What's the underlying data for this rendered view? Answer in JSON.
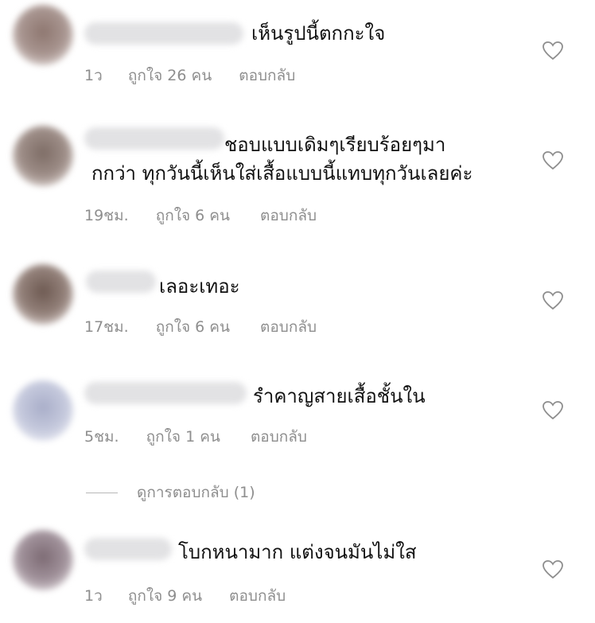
{
  "comments": [
    {
      "text_lines": [
        "เห็นรูปนี้ตกกะใจ"
      ],
      "time": "1ว",
      "likes": "ถูกใจ 26 คน",
      "reply": "ตอบกลับ"
    },
    {
      "text_lines": [
        "ชอบแบบเดิมๆเรียบร้อยๆมา",
        "กกว่า ทุกวันนี้เห็นใส่เสื้อแบบนี้แทบทุกวันเลยค่ะ"
      ],
      "time": "19ชม.",
      "likes": "ถูกใจ 6 คน",
      "reply": "ตอบกลับ"
    },
    {
      "text_lines": [
        "เลอะเทอะ"
      ],
      "time": "17ชม.",
      "likes": "ถูกใจ 6 คน",
      "reply": "ตอบกลับ"
    },
    {
      "text_lines": [
        "รำคาญสายเสื้อชั้นใน"
      ],
      "time": "5ชม.",
      "likes": "ถูกใจ 1 คน",
      "reply": "ตอบกลับ"
    },
    {
      "text_lines": [
        "โบกหนามาก แต่งจนมันไม่ใส"
      ],
      "time": "1ว",
      "likes": "ถูกใจ 9 คน",
      "reply": "ตอบกลับ"
    }
  ],
  "view_replies": "ดูการตอบกลับ (1)",
  "icons": {
    "like": "heart-outline-icon"
  },
  "colors": {
    "text": "#111111",
    "meta": "#8e8e8e",
    "heart_stroke": "#8e8e8e"
  }
}
